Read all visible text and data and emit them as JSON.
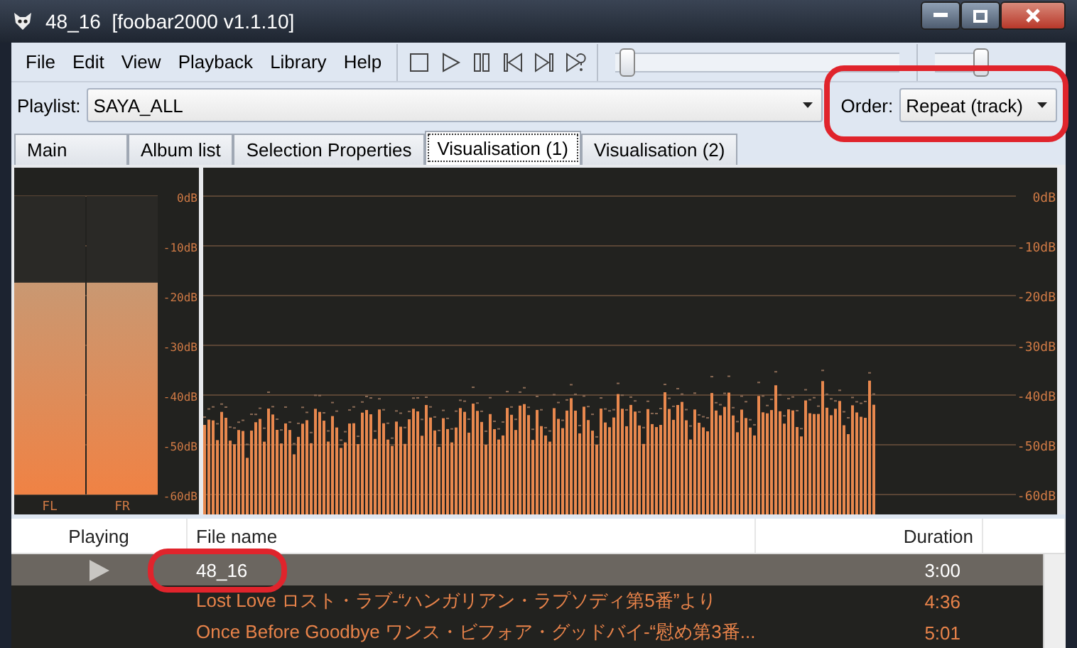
{
  "window": {
    "title": "48_16  [foobar2000 v1.1.10]"
  },
  "menu": [
    "File",
    "Edit",
    "View",
    "Playback",
    "Library",
    "Help"
  ],
  "seek": {
    "level": 0.02
  },
  "volume": {
    "level": 1
  },
  "playlist_selector": {
    "label": "Playlist:",
    "value": "SAYA_ALL"
  },
  "order": {
    "label": "Order:",
    "value": "Repeat (track)",
    "circled": true
  },
  "tabs": [
    {
      "label": "Main",
      "selected": false
    },
    {
      "label": "Album list",
      "selected": false
    },
    {
      "label": "Selection Properties",
      "selected": false
    },
    {
      "label": "Visualisation (1)",
      "selected": true
    },
    {
      "label": "Visualisation (2)",
      "selected": false
    }
  ],
  "peak_meter": {
    "scale": [
      "0dB",
      "-10dB",
      "-20dB",
      "-30dB",
      "-40dB",
      "-50dB",
      "-60dB"
    ],
    "channels": [
      {
        "name": "FL",
        "level": 0.71
      },
      {
        "name": "FR",
        "level": 0.71
      }
    ]
  },
  "spectrum": {
    "scale": [
      "0dB",
      "-10dB",
      "-20dB",
      "-30dB",
      "-40dB",
      "-50dB",
      "-60dB"
    ]
  },
  "playlist": {
    "columns": [
      "Playing",
      "File name",
      "Duration"
    ],
    "rows": [
      {
        "playing": true,
        "selected": true,
        "circled": true,
        "file": "48_16",
        "duration": "3:00"
      },
      {
        "playing": false,
        "selected": false,
        "circled": false,
        "file": "Lost Love ロスト・ラブ-“ハンガリアン・ラプソディ第5番”より",
        "duration": "4:36"
      },
      {
        "playing": false,
        "selected": false,
        "circled": false,
        "file": "Once Before Goodbye ワンス・ビフォア・グッドバイ-“慰め第3番...",
        "duration": "5:01"
      }
    ]
  }
}
